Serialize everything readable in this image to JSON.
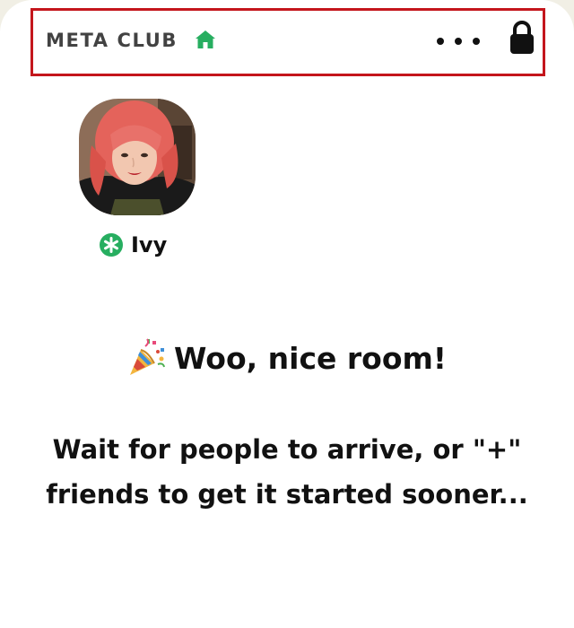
{
  "header": {
    "club_name": "META CLUB",
    "home_icon": "house-icon",
    "more_icon": "more-dots-icon",
    "lock_icon": "lock-icon",
    "accent_color": "#27ae60"
  },
  "speaker": {
    "name": "Ivy",
    "badge_icon": "moderator-asterisk-icon",
    "badge_color": "#27ae60",
    "avatar": "profile-photo"
  },
  "room": {
    "celebrate_icon": "party-popper-icon",
    "celebrate_text": "Woo, nice room!",
    "message": "Wait for people to arrive, or \"+\" friends to get it started sooner..."
  }
}
